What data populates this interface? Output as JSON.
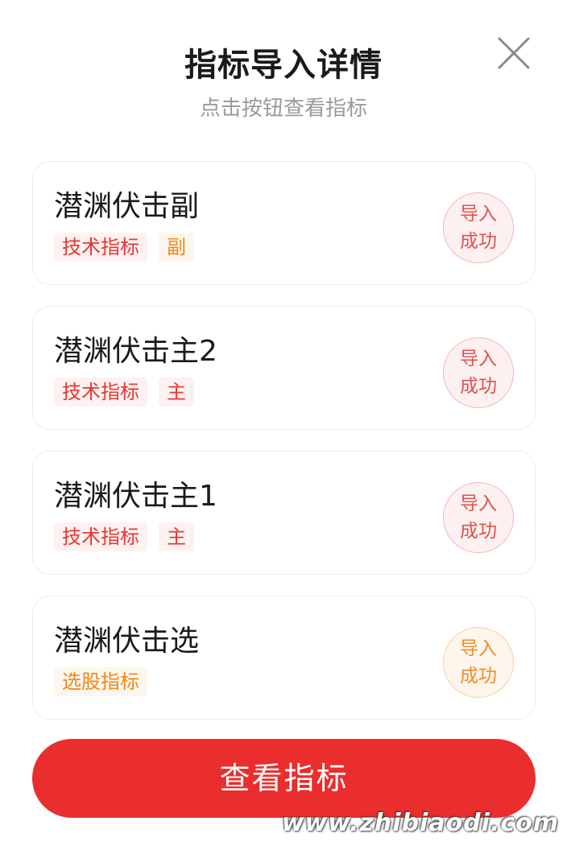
{
  "modal": {
    "title": "指标导入详情",
    "subtitle": "点击按钮查看指标"
  },
  "icons": {
    "close": "close-icon"
  },
  "colors": {
    "primary_red": "#ea2e2e",
    "tag_red": "#e53935",
    "tag_orange": "#ef8a17"
  },
  "items": [
    {
      "name": "潜渊伏击副",
      "tags": [
        {
          "label": "技术指标",
          "color": "red"
        },
        {
          "label": "副",
          "color": "orange"
        }
      ],
      "status_line1": "导入",
      "status_line2": "成功",
      "status_color": "red"
    },
    {
      "name": "潜渊伏击主2",
      "tags": [
        {
          "label": "技术指标",
          "color": "red"
        },
        {
          "label": "主",
          "color": "red"
        }
      ],
      "status_line1": "导入",
      "status_line2": "成功",
      "status_color": "red"
    },
    {
      "name": "潜渊伏击主1",
      "tags": [
        {
          "label": "技术指标",
          "color": "red"
        },
        {
          "label": "主",
          "color": "red"
        }
      ],
      "status_line1": "导入",
      "status_line2": "成功",
      "status_color": "red"
    },
    {
      "name": "潜渊伏击选",
      "tags": [
        {
          "label": "选股指标",
          "color": "orange"
        }
      ],
      "status_line1": "导入",
      "status_line2": "成功",
      "status_color": "orange"
    }
  ],
  "button": {
    "view_label": "查看指标"
  },
  "watermark": "www.zhibiaodi.com"
}
